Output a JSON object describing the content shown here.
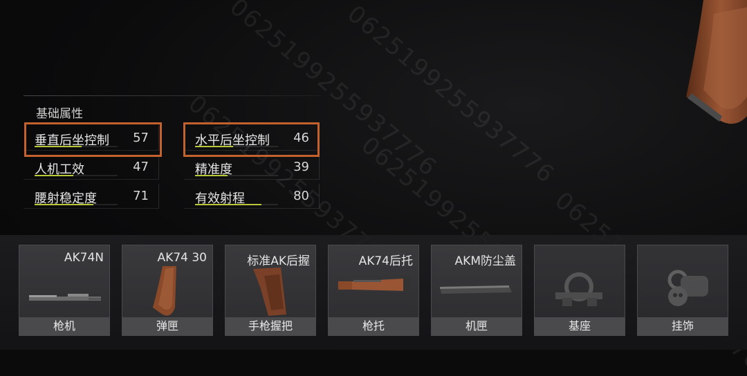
{
  "watermark_text": "0625199255937776",
  "stats": {
    "title": "基础属性",
    "items": [
      {
        "label": "垂直后坐控制",
        "value": "57",
        "level": 0.57,
        "highlighted": true
      },
      {
        "label": "水平后坐控制",
        "value": "46",
        "level": 0.46,
        "highlighted": true
      },
      {
        "label": "人机工效",
        "value": "47",
        "level": 0.47,
        "highlighted": false
      },
      {
        "label": "精准度",
        "value": "39",
        "level": 0.39,
        "highlighted": false
      },
      {
        "label": "腰射稳定度",
        "value": "71",
        "level": 0.71,
        "highlighted": false
      },
      {
        "label": "有效射程",
        "value": "80",
        "level": 0.8,
        "highlighted": false
      }
    ]
  },
  "slots": [
    {
      "name": "AK74N",
      "label": "枪机",
      "icon": "bolt-icon"
    },
    {
      "name": "AK74 30",
      "label": "弹匣",
      "icon": "magazine-icon"
    },
    {
      "name": "标准AK后握",
      "label": "手枪握把",
      "icon": "pistol-grip-icon"
    },
    {
      "name": "AK74后托",
      "label": "枪托",
      "icon": "stock-icon"
    },
    {
      "name": "AKM防尘盖",
      "label": "机匣",
      "icon": "dust-cover-icon"
    },
    {
      "name": "",
      "label": "基座",
      "icon": "mount-icon"
    },
    {
      "name": "",
      "label": "挂饰",
      "icon": "charm-icon"
    }
  ],
  "colors": {
    "highlight": "#c4622d",
    "bar_fill": "#b9c93a",
    "wood": "#8a4a2a"
  }
}
